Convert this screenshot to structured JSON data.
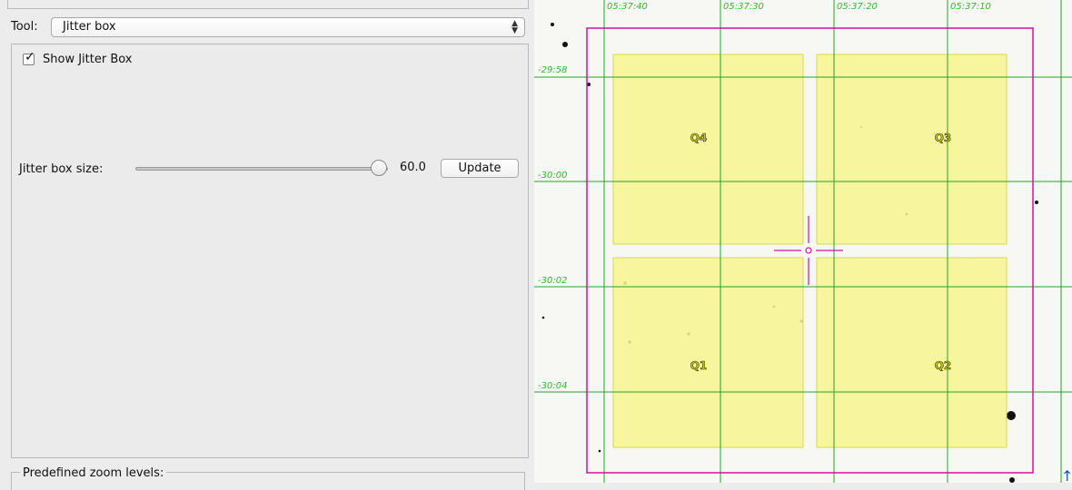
{
  "tool": {
    "label": "Tool:",
    "selected": "Jitter box"
  },
  "jitter": {
    "show_label": "Show Jitter Box",
    "show_checked": true,
    "size_label": "Jitter box size:",
    "size_value": "60.0",
    "slider_fraction": 1.0,
    "update_label": "Update"
  },
  "zoom": {
    "title": "Predefined zoom levels:"
  },
  "sky": {
    "ra_labels": [
      "05:37:40",
      "05:37:30",
      "05:37:20",
      "05:37:10"
    ],
    "dec_labels": [
      "-29:58",
      "-30:00",
      "-30:02",
      "-30:04"
    ],
    "quadrants": [
      "Q4",
      "Q3",
      "Q1",
      "Q2"
    ],
    "colors": {
      "grid": "#2aa02a",
      "label": "#2fb82f",
      "box": "#d8109a",
      "quadrant_fill": "#f7f58d",
      "quadrant_stroke": "#d8d84a"
    }
  }
}
